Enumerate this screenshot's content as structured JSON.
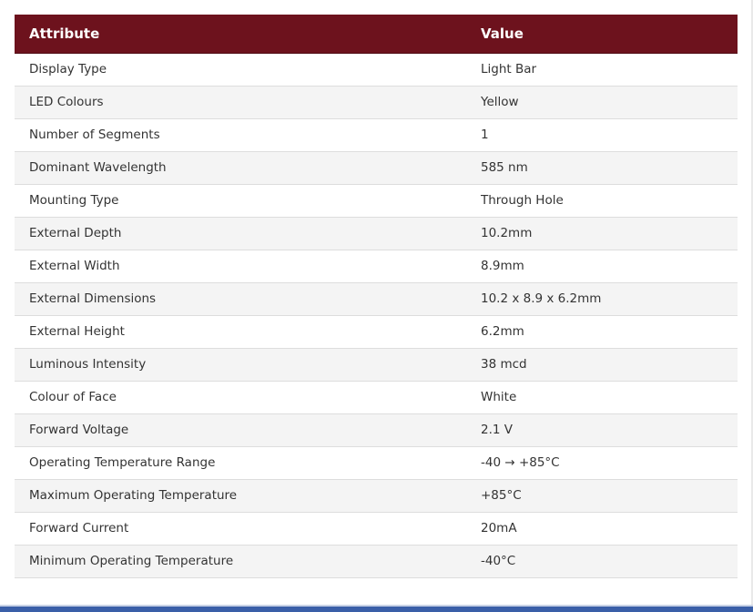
{
  "table": {
    "headers": {
      "attribute": "Attribute",
      "value": "Value"
    },
    "rows": [
      {
        "attribute": "Display Type",
        "value": "Light Bar"
      },
      {
        "attribute": "LED Colours",
        "value": "Yellow"
      },
      {
        "attribute": "Number of Segments",
        "value": "1"
      },
      {
        "attribute": "Dominant Wavelength",
        "value": "585 nm"
      },
      {
        "attribute": "Mounting Type",
        "value": "Through Hole"
      },
      {
        "attribute": "External Depth",
        "value": "10.2mm"
      },
      {
        "attribute": "External Width",
        "value": "8.9mm"
      },
      {
        "attribute": "External Dimensions",
        "value": "10.2 x 8.9 x 6.2mm"
      },
      {
        "attribute": "External Height",
        "value": "6.2mm"
      },
      {
        "attribute": "Luminous Intensity",
        "value": "38 mcd"
      },
      {
        "attribute": "Colour of Face",
        "value": "White"
      },
      {
        "attribute": "Forward Voltage",
        "value": "2.1 V"
      },
      {
        "attribute": "Operating Temperature Range",
        "value": "-40 → +85°C"
      },
      {
        "attribute": "Maximum Operating Temperature",
        "value": "+85°C"
      },
      {
        "attribute": "Forward Current",
        "value": "20mA"
      },
      {
        "attribute": "Minimum Operating Temperature",
        "value": "-40°C"
      }
    ]
  },
  "colors": {
    "header_background": "#6d121d",
    "header_text": "#ffffff",
    "row_alt_background": "#f4f4f4",
    "bottom_bar": "#3a5fa8"
  }
}
